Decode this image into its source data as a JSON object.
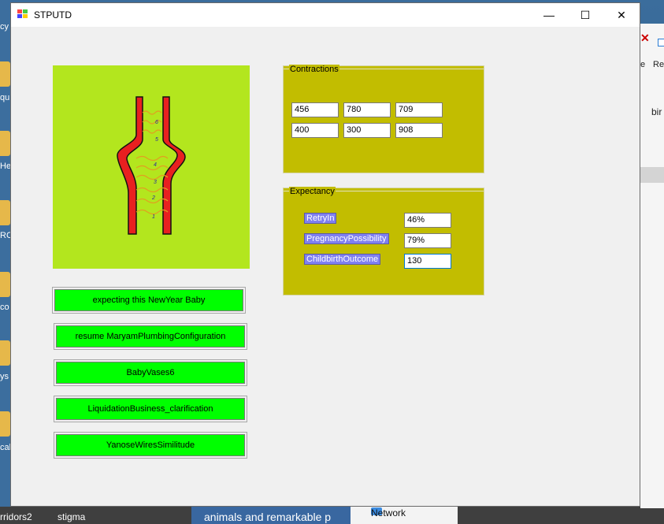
{
  "desktop": {
    "labels": [
      "cy",
      "qu",
      "He",
      "RC",
      "co",
      "ys",
      "cal",
      "rridors2",
      "stigma"
    ],
    "taskbar": {
      "network": "Network",
      "preview": "animals and remarkable p"
    },
    "right_panel": {
      "t1": "e",
      "t2": "Re",
      "t3": "bir"
    }
  },
  "window": {
    "title": "STPUTD",
    "controls": {
      "minimize": "—",
      "maximize": "☐",
      "close": "✕"
    }
  },
  "canvas": {
    "background": "#b3e61e",
    "vessel_color": "#e82020",
    "spring_color": "#e0a020",
    "numbers": [
      "6",
      "5",
      "4",
      "3",
      "2",
      "1"
    ]
  },
  "actions": [
    "expecting this NewYear Baby",
    "resume MaryamPlumbingConfiguration",
    "BabyVases6",
    "LiquidationBusiness_clarification",
    "YanoseWiresSimilitude"
  ],
  "contractions": {
    "title": "Contractions",
    "values": [
      "456",
      "780",
      "709",
      "400",
      "300",
      "908"
    ]
  },
  "expectancy": {
    "title": "Expectancy",
    "rows": [
      {
        "label": "RetryIn",
        "value": "46%"
      },
      {
        "label": "PregnancyPossibility",
        "value": "79%"
      },
      {
        "label": "ChildbirthOutcome",
        "value": "130"
      }
    ]
  },
  "colors": {
    "accent_green": "#00ff00",
    "group_olive": "#c2bd00",
    "label_purple": "#8080f0"
  }
}
